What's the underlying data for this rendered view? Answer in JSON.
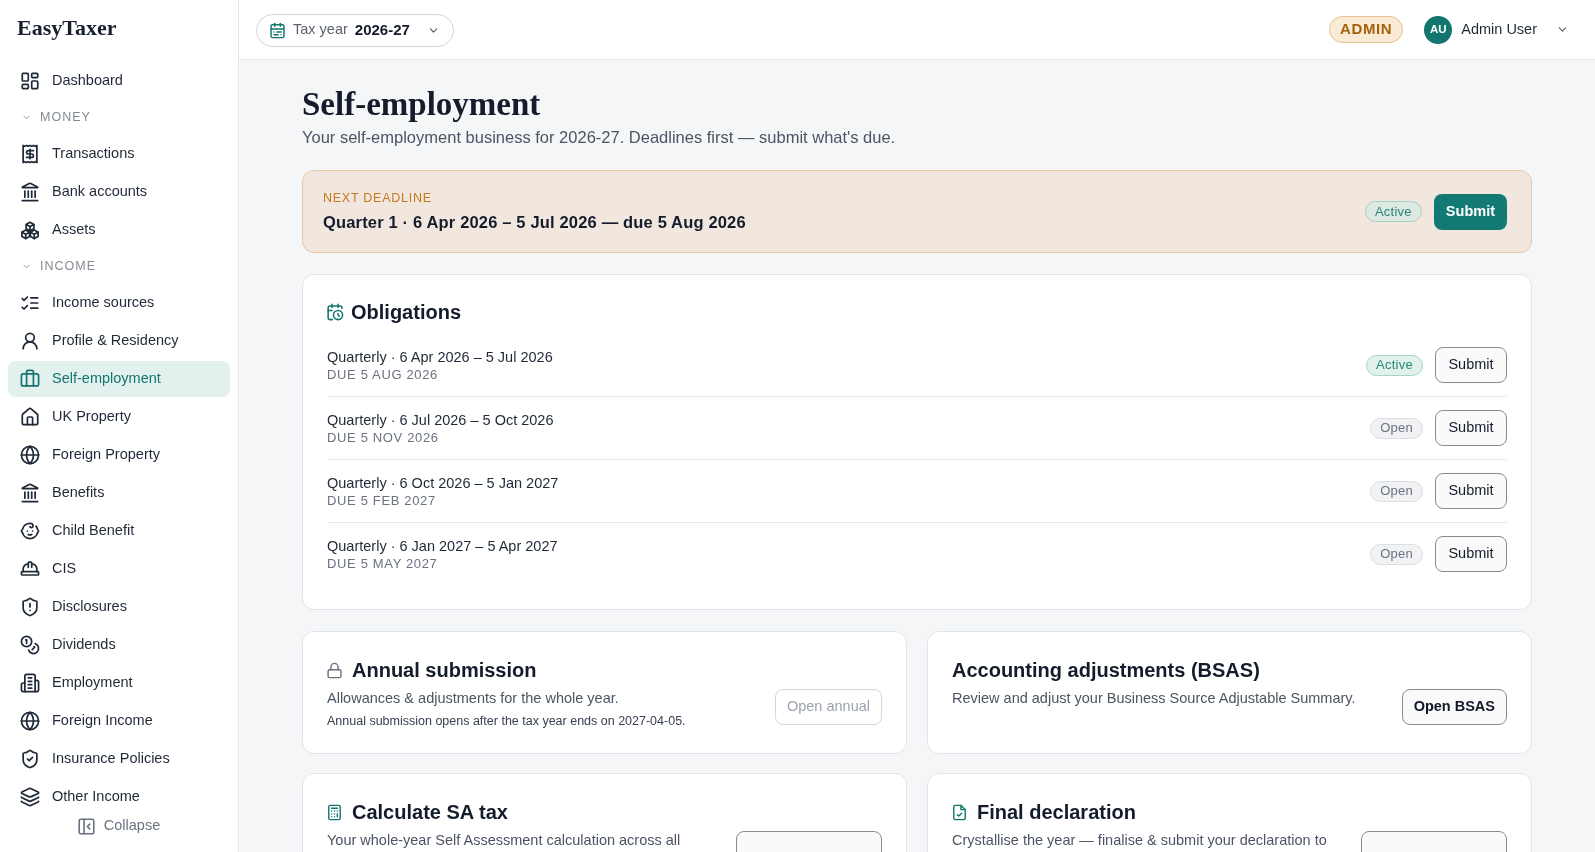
{
  "sidebar": {
    "logo": "EasyTaxer",
    "nav": [
      {
        "kind": "item",
        "label": "Dashboard",
        "selected": false
      },
      {
        "kind": "section",
        "label": "MONEY",
        "expanded": true,
        "children": [
          {
            "label": "Transactions",
            "selected": false
          },
          {
            "label": "Bank accounts",
            "selected": false
          },
          {
            "label": "Assets",
            "selected": false
          }
        ]
      },
      {
        "kind": "section",
        "label": "INCOME",
        "expanded": true,
        "children": [
          {
            "label": "Income sources",
            "selected": false
          },
          {
            "label": "Profile & Residency",
            "selected": false
          },
          {
            "label": "Self-employment",
            "selected": true
          },
          {
            "label": "UK Property",
            "selected": false
          },
          {
            "label": "Foreign Property",
            "selected": false
          },
          {
            "label": "Benefits",
            "selected": false
          },
          {
            "label": "Child Benefit",
            "selected": false
          },
          {
            "label": "CIS",
            "selected": false
          },
          {
            "label": "Disclosures",
            "selected": false
          },
          {
            "label": "Dividends",
            "selected": false
          },
          {
            "label": "Employment",
            "selected": false
          },
          {
            "label": "Foreign Income",
            "selected": false
          },
          {
            "label": "Insurance Policies",
            "selected": false
          },
          {
            "label": "Other Income",
            "selected": false
          }
        ]
      }
    ],
    "collapse": "Collapse"
  },
  "topbar": {
    "tax_year": {
      "label": "Tax year",
      "value": "2026-27"
    },
    "role": "ADMIN",
    "user": {
      "initials": "AU",
      "name": "Admin User"
    }
  },
  "page": {
    "title": "Self-employment",
    "subtitle": "Your self-employment business for 2026-27. Deadlines first — submit what's due."
  },
  "next_deadline": {
    "label": "NEXT DEADLINE",
    "period": "Quarter 1 · 6 Apr 2026 – 5 Jul 2026 — due 5 Aug 2026",
    "status": {
      "kind": "active",
      "label": "Active"
    },
    "button": "Submit"
  },
  "obligations": {
    "title": "Obligations",
    "rows": [
      {
        "period": "Quarterly · 6 Apr 2026 – 5 Jul 2026",
        "due": "DUE 5 AUG 2026",
        "status": {
          "kind": "active",
          "label": "Active"
        },
        "button": "Submit"
      },
      {
        "period": "Quarterly · 6 Jul 2026 – 5 Oct 2026",
        "due": "DUE 5 NOV 2026",
        "status": {
          "kind": "open",
          "label": "Open"
        },
        "button": "Submit"
      },
      {
        "period": "Quarterly · 6 Oct 2026 – 5 Jan 2027",
        "due": "DUE 5 FEB 2027",
        "status": {
          "kind": "open",
          "label": "Open"
        },
        "button": "Submit"
      },
      {
        "period": "Quarterly · 6 Jan 2027 – 5 Apr 2027",
        "due": "DUE 5 MAY 2027",
        "status": {
          "kind": "open",
          "label": "Open"
        },
        "button": "Submit"
      }
    ]
  },
  "cards": [
    {
      "title": "Annual submission",
      "description": "Allowances & adjustments for the whole year.",
      "note": "Annual submission opens after the tax year ends on 2027-04-05.",
      "button": {
        "label": "Open annual",
        "disabled": true
      }
    },
    {
      "title": "Accounting adjustments (BSAS)",
      "description": "Review and adjust your Business Source Adjustable Summary.",
      "button": {
        "label": "Open BSAS",
        "disabled": false
      }
    },
    {
      "title": "Calculate SA tax",
      "description": "Your whole-year Self Assessment calculation across all",
      "button": {
        "disabled": false
      }
    },
    {
      "title": "Final declaration",
      "description": "Crystallise the year — finalise & submit your declaration to",
      "button": {
        "disabled": false
      }
    }
  ]
}
